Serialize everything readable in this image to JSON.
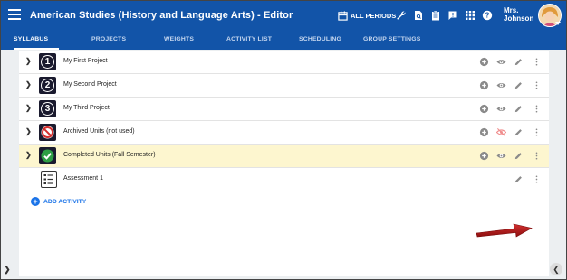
{
  "header": {
    "app_title": "American Studies (History and Language Arts) - Editor",
    "periods_label": "ALL PERIODS",
    "user_line1": "Mrs.",
    "user_line2": "Johnson",
    "color": "#1254a8",
    "icons": [
      "wrench-icon",
      "document-search-icon",
      "clipboard-icon",
      "feedback-icon",
      "apps-grid-icon",
      "help-icon"
    ]
  },
  "tabs": [
    {
      "label": "SYLLABUS",
      "active": true
    },
    {
      "label": "PROJECTS"
    },
    {
      "label": "WEIGHTS"
    },
    {
      "label": "ACTIVITY LIST"
    },
    {
      "label": "SCHEDULING"
    },
    {
      "label": "GROUP SETTINGS"
    }
  ],
  "rows": [
    {
      "icon_text": "1",
      "label": "My First Project"
    },
    {
      "icon_text": "2",
      "label": "My Second Project"
    },
    {
      "icon_text": "3",
      "label": "My Third Project"
    },
    {
      "label": "Archived Units (not used)",
      "icon": "no-entry-icon",
      "hidden": true
    },
    {
      "label": "Completed Units (Fall Semester)",
      "icon": "checkmark-icon",
      "highlight": true
    },
    {
      "label": "Assessment 1",
      "icon": "checklist-icon"
    }
  ],
  "add_activity_label": "ADD ACTIVITY",
  "annotation": {
    "arrow_color": "#b71c1c"
  }
}
